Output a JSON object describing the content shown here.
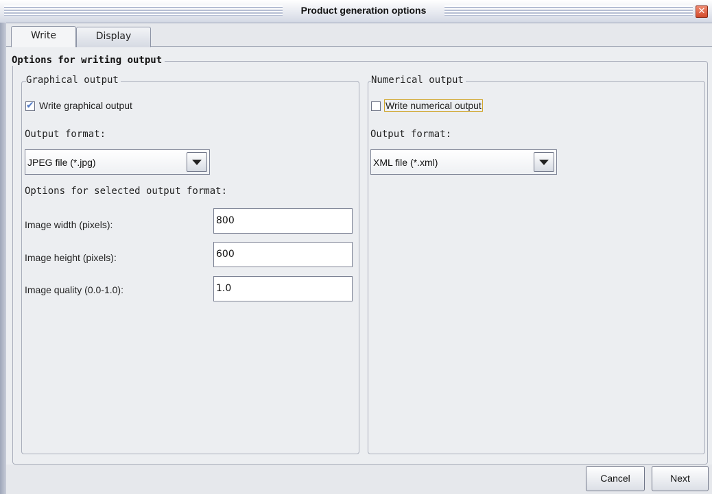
{
  "window": {
    "title": "Product generation options",
    "close_glyph": "✕"
  },
  "tabs": [
    {
      "label": "Write",
      "active": true
    },
    {
      "label": "Display",
      "active": false
    }
  ],
  "main_group": {
    "legend": "Options for writing output"
  },
  "graphical": {
    "legend": "Graphical output",
    "checkbox_label": "Write graphical output",
    "checked": true,
    "format_label": "Output format:",
    "format_value": "JPEG file (*.jpg)",
    "options_label": "Options for selected output format:",
    "width_label": "Image width (pixels):",
    "width_value": "800",
    "height_label": "Image height (pixels):",
    "height_value": "600",
    "quality_label": "Image quality (0.0-1.0):",
    "quality_value": "1.0"
  },
  "numerical": {
    "legend": "Numerical output",
    "checkbox_label": "Write numerical output",
    "checked": false,
    "format_label": "Output format:",
    "format_value": "XML file (*.xml)"
  },
  "buttons": {
    "cancel": "Cancel",
    "next": "Next"
  },
  "colors": {
    "window_bg": "#eceef1",
    "check_color": "#4f78c4",
    "focus_border": "#d0a52a",
    "close_button": "#d24a2c"
  },
  "icons": {
    "close": "close-icon",
    "check": "checkmark-icon",
    "dropdown": "chevron-down-icon"
  }
}
